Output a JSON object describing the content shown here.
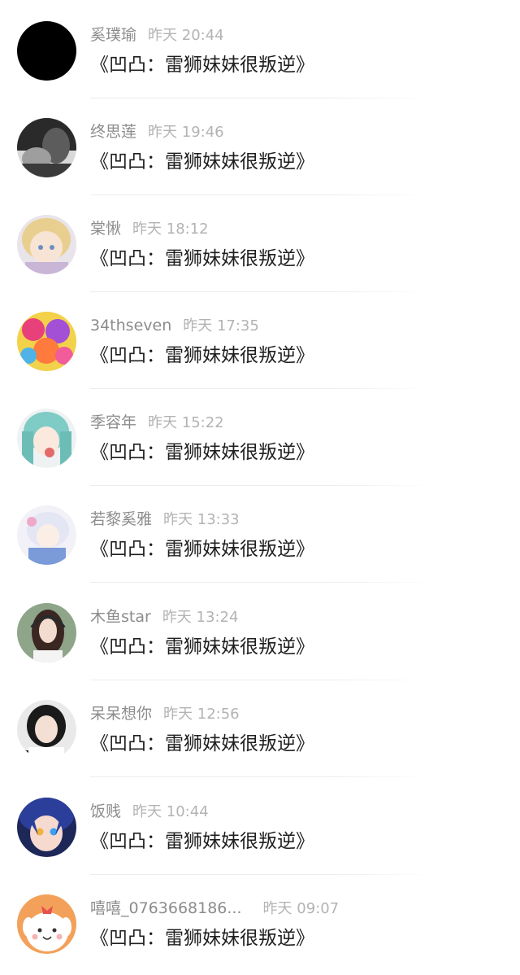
{
  "messages": [
    {
      "name": "奚璞瑜",
      "time": "昨天 20:44",
      "text": "《凹凸：雷狮妹妹很叛逆》",
      "avatar_icon": "black-circle-avatar"
    },
    {
      "name": "终思莲",
      "time": "昨天 19:46",
      "text": "《凹凸：雷狮妹妹很叛逆》",
      "avatar_icon": "grayscale-portrait-avatar"
    },
    {
      "name": "棠愀",
      "time": "昨天 18:12",
      "text": "《凹凸：雷狮妹妹很叛逆》",
      "avatar_icon": "anime-blonde-girl-avatar"
    },
    {
      "name": "34thseven",
      "time": "昨天 17:35",
      "text": "《凹凸：雷狮妹妹很叛逆》",
      "avatar_icon": "colorful-illustration-avatar"
    },
    {
      "name": "季容年",
      "time": "昨天 15:22",
      "text": "《凹凸：雷狮妹妹很叛逆》",
      "avatar_icon": "teal-hair-anime-avatar"
    },
    {
      "name": "若黎奚雅",
      "time": "昨天 13:33",
      "text": "《凹凸：雷狮妹妹很叛逆》",
      "avatar_icon": "white-hair-anime-avatar"
    },
    {
      "name": "木鱼star",
      "time": "昨天 13:24",
      "text": "《凹凸：雷狮妹妹很叛逆》",
      "avatar_icon": "headphones-girl-avatar"
    },
    {
      "name": "呆呆想你",
      "time": "昨天 12:56",
      "text": "《凹凸：雷狮妹妹很叛逆》",
      "avatar_icon": "photo-girl-avatar"
    },
    {
      "name": "饭贱",
      "time": "昨天 10:44",
      "text": "《凹凸：雷狮妹妹很叛逆》",
      "avatar_icon": "blue-hair-anime-avatar"
    },
    {
      "name": "嘻嘻_0763668186...",
      "time": "昨天 09:07",
      "text": "《凹凸：雷狮妹妹很叛逆》",
      "avatar_icon": "cartoon-dog-avatar"
    }
  ]
}
